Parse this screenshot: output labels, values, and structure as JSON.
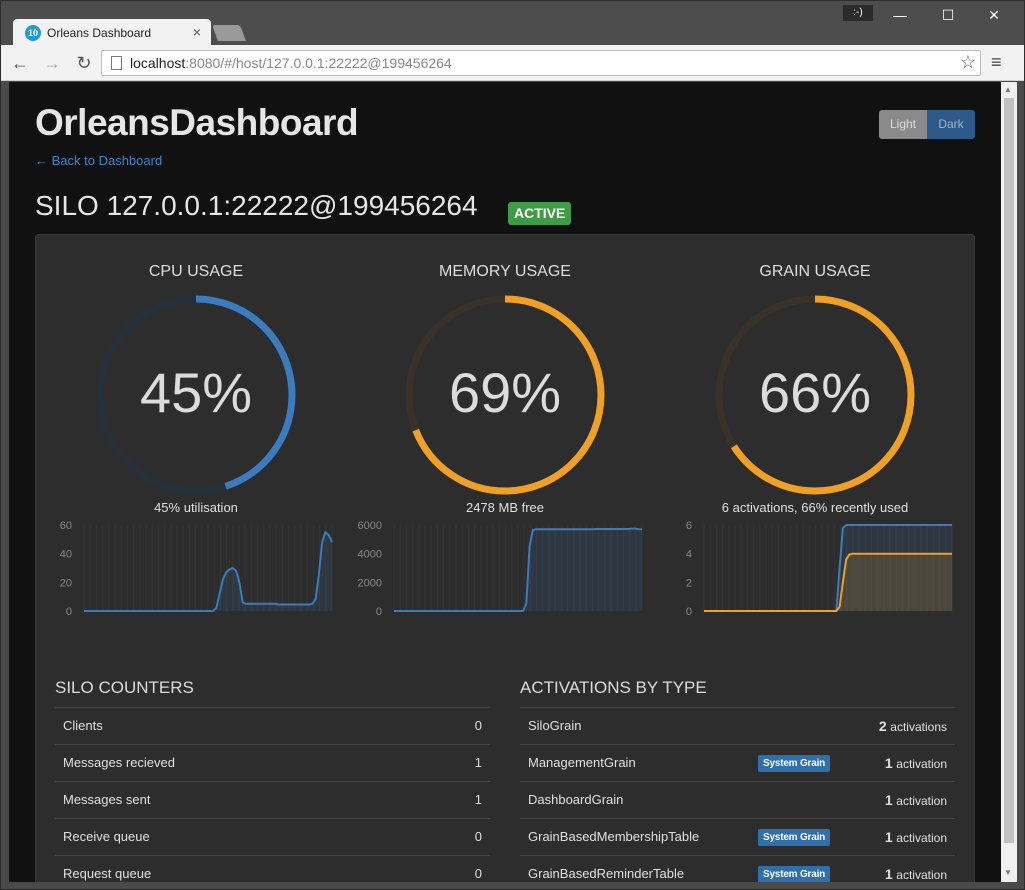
{
  "browser": {
    "tab_title": "Orleans Dashboard",
    "tab_favicon_text": "10",
    "tab_close": "×",
    "profile_label": ":-)",
    "url_host": "localhost",
    "url_rest": ":8080/#/host/127.0.0.1:22222@199456264",
    "window_controls": {
      "minimize": "—",
      "maximize": "☐",
      "close": "✕"
    }
  },
  "header": {
    "brand": "OrleansDashboard",
    "back_link": "← Back to Dashboard",
    "theme_light": "Light",
    "theme_dark": "Dark"
  },
  "silo": {
    "title": "SILO 127.0.0.1:22222@199456264",
    "status": "ACTIVE"
  },
  "gauges": {
    "cpu": {
      "title": "CPU USAGE",
      "value": "45%",
      "fraction": 0.45,
      "subtitle": "45% utilisation",
      "color": "#3c7bbd"
    },
    "memory": {
      "title": "MEMORY USAGE",
      "value": "69%",
      "fraction": 0.69,
      "subtitle": "2478 MB free",
      "color": "#f0a024"
    },
    "grain": {
      "title": "GRAIN USAGE",
      "value": "66%",
      "fraction": 0.66,
      "subtitle": "6 activations, 66% recently used",
      "color": "#f0a024"
    }
  },
  "chart_data": [
    {
      "type": "area",
      "name": "cpu-history",
      "ylim": [
        0,
        60
      ],
      "yticks": [
        "0",
        "20",
        "40",
        "60"
      ],
      "series": [
        {
          "color": "#3c7bbd",
          "values": [
            0,
            0,
            0,
            0,
            0,
            0,
            0,
            0,
            0,
            0,
            0,
            0,
            0,
            0,
            0,
            0,
            0,
            0,
            0,
            0,
            0,
            0,
            0,
            0,
            0,
            0,
            0,
            0,
            0,
            0,
            0,
            0,
            0,
            0,
            0,
            0,
            0,
            0,
            0,
            0,
            2,
            12,
            22,
            27,
            29,
            30,
            28,
            20,
            6,
            5,
            5,
            5,
            5,
            5,
            5,
            5,
            5,
            5,
            5,
            4.5,
            4.5,
            4.5,
            4.5,
            4.5,
            4.5,
            4.5,
            4.5,
            4.5,
            4.5,
            5,
            8,
            25,
            48,
            55,
            53,
            48
          ]
        }
      ]
    },
    {
      "type": "area",
      "name": "memory-history",
      "ylim": [
        0,
        6000
      ],
      "yticks": [
        "0",
        "2000",
        "4000",
        "6000"
      ],
      "series": [
        {
          "color": "#3c7bbd",
          "values": [
            0,
            0,
            0,
            0,
            0,
            0,
            0,
            0,
            0,
            0,
            0,
            0,
            0,
            0,
            0,
            0,
            0,
            0,
            0,
            0,
            0,
            0,
            0,
            0,
            0,
            0,
            0,
            0,
            0,
            0,
            0,
            0,
            0,
            0,
            0,
            0,
            0,
            0,
            0,
            0,
            500,
            4500,
            5650,
            5700,
            5700,
            5700,
            5700,
            5700,
            5700,
            5700,
            5700,
            5700,
            5700,
            5700,
            5700,
            5700,
            5700,
            5700,
            5700,
            5700,
            5700,
            5720,
            5720,
            5720,
            5720,
            5720,
            5720,
            5720,
            5720,
            5720,
            5720,
            5720,
            5750,
            5750,
            5700,
            5700
          ]
        }
      ]
    },
    {
      "type": "area",
      "name": "grain-history",
      "ylim": [
        0,
        6
      ],
      "yticks": [
        "0",
        "2",
        "4",
        "6"
      ],
      "series": [
        {
          "color": "#3c7bbd",
          "values": [
            0,
            0,
            0,
            0,
            0,
            0,
            0,
            0,
            0,
            0,
            0,
            0,
            0,
            0,
            0,
            0,
            0,
            0,
            0,
            0,
            0,
            0,
            0,
            0,
            0,
            0,
            0,
            0,
            0,
            0,
            0,
            0,
            0,
            0,
            0,
            0,
            0,
            0,
            0,
            0,
            0,
            3,
            5.8,
            6,
            6,
            6,
            6,
            6,
            6,
            6,
            6,
            6,
            6,
            6,
            6,
            6,
            6,
            6,
            6,
            6,
            6,
            6,
            6,
            6,
            6,
            6,
            6,
            6,
            6,
            6,
            6,
            6,
            6,
            6,
            6,
            6
          ]
        },
        {
          "color": "#f0a024",
          "values": [
            0,
            0,
            0,
            0,
            0,
            0,
            0,
            0,
            0,
            0,
            0,
            0,
            0,
            0,
            0,
            0,
            0,
            0,
            0,
            0,
            0,
            0,
            0,
            0,
            0,
            0,
            0,
            0,
            0,
            0,
            0,
            0,
            0,
            0,
            0,
            0,
            0,
            0,
            0,
            0,
            0,
            0.3,
            2,
            3.6,
            3.95,
            4,
            4,
            4,
            4,
            4,
            4,
            4,
            4,
            4,
            4,
            4,
            4,
            4,
            4,
            4,
            4,
            4,
            4,
            4,
            4,
            4,
            4,
            4,
            4,
            4,
            4,
            4,
            4,
            4,
            4,
            4
          ]
        }
      ]
    }
  ],
  "counters": {
    "title": "SILO COUNTERS",
    "rows": [
      {
        "label": "Clients",
        "value": "0"
      },
      {
        "label": "Messages recieved",
        "value": "1"
      },
      {
        "label": "Messages sent",
        "value": "1"
      },
      {
        "label": "Receive queue",
        "value": "0"
      },
      {
        "label": "Request queue",
        "value": "0"
      }
    ]
  },
  "activations": {
    "title": "ACTIVATIONS BY TYPE",
    "rows": [
      {
        "label": "SiloGrain",
        "badge": "",
        "count": "2",
        "unit": "activations"
      },
      {
        "label": "ManagementGrain",
        "badge": "System Grain",
        "count": "1",
        "unit": "activation"
      },
      {
        "label": "DashboardGrain",
        "badge": "",
        "count": "1",
        "unit": "activation"
      },
      {
        "label": "GrainBasedMembershipTable",
        "badge": "System Grain",
        "count": "1",
        "unit": "activation"
      },
      {
        "label": "GrainBasedReminderTable",
        "badge": "System Grain",
        "count": "1",
        "unit": "activation"
      }
    ]
  }
}
